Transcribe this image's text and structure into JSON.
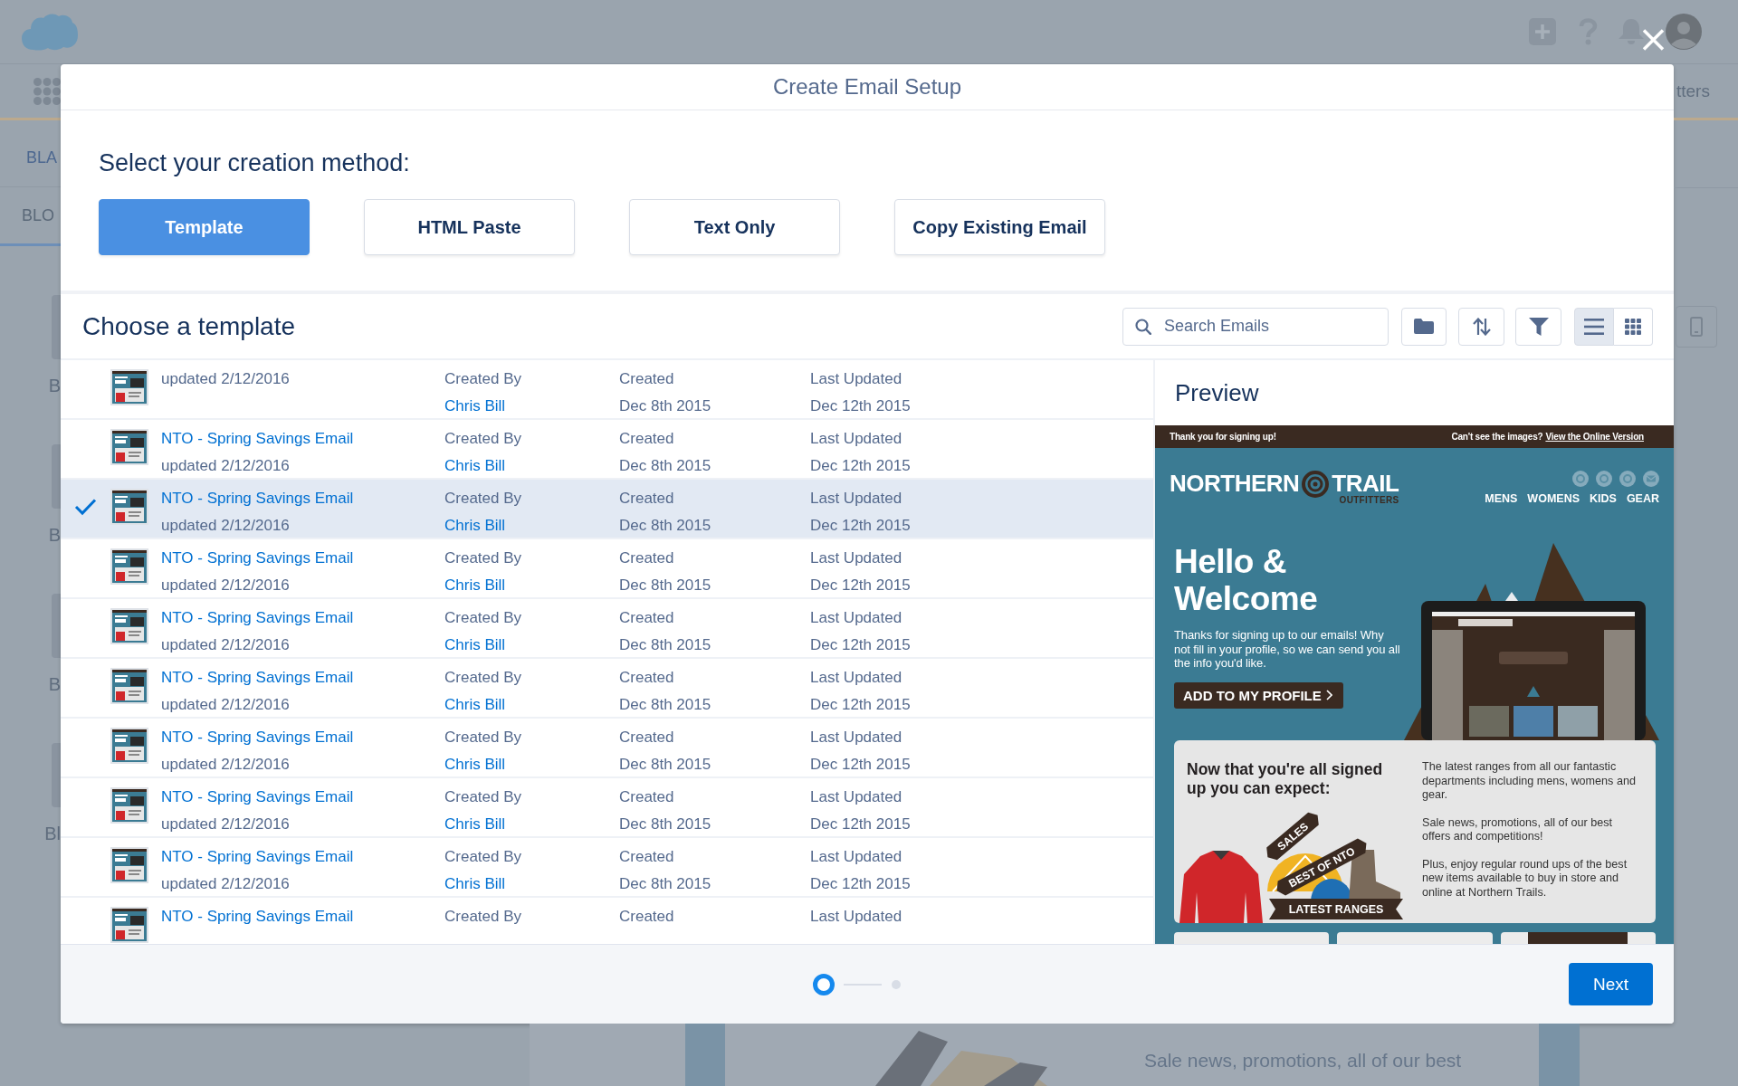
{
  "header": {
    "nav_label": "tters"
  },
  "side_tabs": [
    {
      "label": "BLA",
      "selected": false
    },
    {
      "label": "BLO",
      "selected": true
    }
  ],
  "side_cards": [
    {
      "label": "B"
    },
    {
      "label": "B"
    },
    {
      "label": "B"
    },
    {
      "label": "Bl"
    }
  ],
  "background_text": "Sale news, promotions, all of our best",
  "modal": {
    "title": "Create Email Setup",
    "method_prompt": "Select your creation method:",
    "methods": [
      {
        "label": "Template",
        "selected": true
      },
      {
        "label": "HTML Paste",
        "selected": false
      },
      {
        "label": "Text Only",
        "selected": false
      },
      {
        "label": "Copy Existing Email",
        "selected": false
      }
    ],
    "section_title": "Choose a template",
    "search": {
      "placeholder": "Search Emails"
    },
    "view_modes": [
      {
        "kind": "list",
        "selected": true
      },
      {
        "kind": "grid",
        "selected": false
      }
    ],
    "templates": [
      {
        "updated": "updated 2/12/2016",
        "created_by_label": "Created By",
        "created_by": "Chris Bill",
        "created_label": "Created",
        "created": "Dec 8th 2015",
        "last_updated_label": "Last Updated",
        "last_updated": "Dec 12th 2015",
        "selected": false
      },
      {
        "name": "NTO - Spring Savings Email",
        "updated": "updated 2/12/2016",
        "created_by_label": "Created By",
        "created_by": "Chris Bill",
        "created_label": "Created",
        "created": "Dec 8th 2015",
        "last_updated_label": "Last Updated",
        "last_updated": "Dec 12th 2015",
        "selected": false
      },
      {
        "name": "NTO - Spring Savings Email",
        "updated": "updated 2/12/2016",
        "created_by_label": "Created By",
        "created_by": "Chris Bill",
        "created_label": "Created",
        "created": "Dec 8th 2015",
        "last_updated_label": "Last Updated",
        "last_updated": "Dec 12th 2015",
        "selected": true
      },
      {
        "name": "NTO - Spring Savings Email",
        "updated": "updated 2/12/2016",
        "created_by_label": "Created By",
        "created_by": "Chris Bill",
        "created_label": "Created",
        "created": "Dec 8th 2015",
        "last_updated_label": "Last Updated",
        "last_updated": "Dec 12th 2015",
        "selected": false
      },
      {
        "name": "NTO - Spring Savings Email",
        "updated": "updated 2/12/2016",
        "created_by_label": "Created By",
        "created_by": "Chris Bill",
        "created_label": "Created",
        "created": "Dec 8th 2015",
        "last_updated_label": "Last Updated",
        "last_updated": "Dec 12th 2015",
        "selected": false
      },
      {
        "name": "NTO - Spring Savings Email",
        "updated": "updated 2/12/2016",
        "created_by_label": "Created By",
        "created_by": "Chris Bill",
        "created_label": "Created",
        "created": "Dec 8th 2015",
        "last_updated_label": "Last Updated",
        "last_updated": "Dec 12th 2015",
        "selected": false
      },
      {
        "name": "NTO - Spring Savings Email",
        "updated": "updated 2/12/2016",
        "created_by_label": "Created By",
        "created_by": "Chris Bill",
        "created_label": "Created",
        "created": "Dec 8th 2015",
        "last_updated_label": "Last Updated",
        "last_updated": "Dec 12th 2015",
        "selected": false
      },
      {
        "name": "NTO - Spring Savings Email",
        "updated": "updated 2/12/2016",
        "created_by_label": "Created By",
        "created_by": "Chris Bill",
        "created_label": "Created",
        "created": "Dec 8th 2015",
        "last_updated_label": "Last Updated",
        "last_updated": "Dec 12th 2015",
        "selected": false
      },
      {
        "name": "NTO - Spring Savings Email",
        "updated": "updated 2/12/2016",
        "created_by_label": "Created By",
        "created_by": "Chris Bill",
        "created_label": "Created",
        "created": "Dec 8th 2015",
        "last_updated_label": "Last Updated",
        "last_updated": "Dec 12th 2015",
        "selected": false
      },
      {
        "name": "NTO - Spring Savings Email",
        "created_by_label": "Created By",
        "created_label": "Created",
        "last_updated_label": "Last Updated",
        "selected": false
      }
    ],
    "preview": {
      "title": "Preview",
      "email": {
        "greeting": "Thank you for signing up!",
        "images_prompt": "Can't see the images?",
        "online_link": "View the Online Version",
        "brand": {
          "name_left": "NORTHERN",
          "name_right": "TRAIL",
          "tagline": "OUTFITTERS"
        },
        "nav": [
          "MENS",
          "WOMENS",
          "KIDS",
          "GEAR"
        ],
        "headline": "Hello & Welcome",
        "intro": "Thanks for signing up to our emails! Why not fill in your profile, so we can send you all the info you'd like.",
        "cta": "ADD TO MY PROFILE",
        "expect_title": "Now that you're all signed up you can expect:",
        "expect_items": [
          "The latest ranges from all our fantastic departments including mens, womens and gear.",
          "Sale news, promotions, all of our best offers and competitions!",
          "Plus, enjoy regular round ups of the best new items available to buy in store and online at Northern Trails."
        ],
        "ribbons": [
          "SALES",
          "BEST OF NTO",
          "LATEST RANGES"
        ]
      }
    },
    "steps": [
      {
        "selected": true
      },
      {
        "selected": false
      }
    ],
    "next_button": "Next"
  }
}
